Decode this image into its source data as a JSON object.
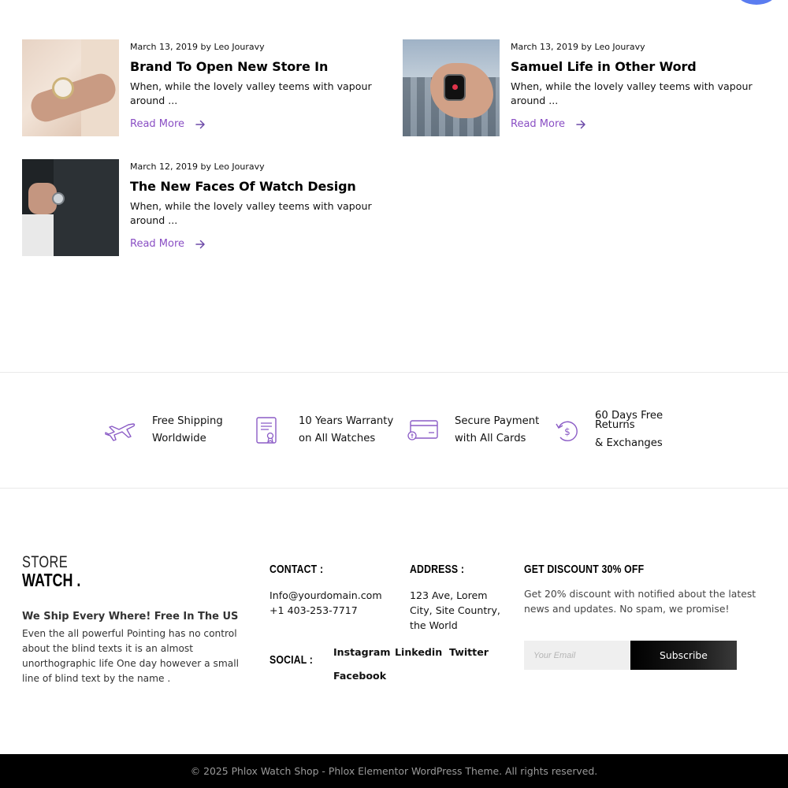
{
  "posts": [
    {
      "date": "March 13, 2019",
      "author": "by Leo Jouravy",
      "title": "Brand To Open New Store In",
      "excerpt": "When, while the lovely valley teems with vapour around ...",
      "read_more": "Read More"
    },
    {
      "date": "March 13, 2019",
      "author": "by Leo Jouravy",
      "title": "Samuel Life in Other Word",
      "excerpt": "When, while the lovely valley teems with vapour around ...",
      "read_more": "Read More"
    },
    {
      "date": "March 12, 2019",
      "author": "by Leo Jouravy",
      "title": "The New Faces Of Watch Design",
      "excerpt": "When, while the lovely valley teems with vapour around ...",
      "read_more": "Read More"
    }
  ],
  "features": [
    {
      "icon": "airplane-icon",
      "line1": "Free Shipping",
      "line2": "Worldwide"
    },
    {
      "icon": "certificate-icon",
      "line1": "10 Years Warranty",
      "line2": "on All Watches"
    },
    {
      "icon": "credit-card-icon",
      "line1": "Secure Payment",
      "line2": "with All Cards"
    },
    {
      "icon": "refund-icon",
      "line1": "60 Days Free Returns",
      "line2": "& Exchanges"
    }
  ],
  "footer": {
    "logo_line1": "STORE",
    "logo_line2": "WATCH .",
    "ship_title": "We Ship Every Where! Free In The US",
    "ship_text": "Even the all powerful Pointing has no control about the blind texts it is an almost unorthographic life One day however a small line of blind text by the name .",
    "contact_heading": "CONTACT :",
    "contact_email": "Info@yourdomain.com",
    "contact_phone": "+1 403-253-7717",
    "address_heading": "ADDRESS :",
    "address_text": "123 Ave, Lorem City, Site Country, the World",
    "social_heading": "SOCIAL :",
    "social_links": [
      "Instagram",
      "Linkedin",
      "Twitter",
      "Facebook"
    ],
    "discount_heading": "GET DISCOUNT 30% OFF",
    "discount_text": "Get 20% discount with notified about the latest news and updates. No spam, we promise!",
    "email_placeholder": "Your Email",
    "subscribe_label": "Subscribe",
    "copyright": "© 2025 Phlox Watch Shop - Phlox Elementor WordPress Theme. All rights reserved."
  },
  "colors": {
    "accent": "#8a4fc4",
    "icon_purple": "#8b5cc6",
    "fab_blue": "#5a7cf0",
    "footer_bar": "#000000"
  }
}
